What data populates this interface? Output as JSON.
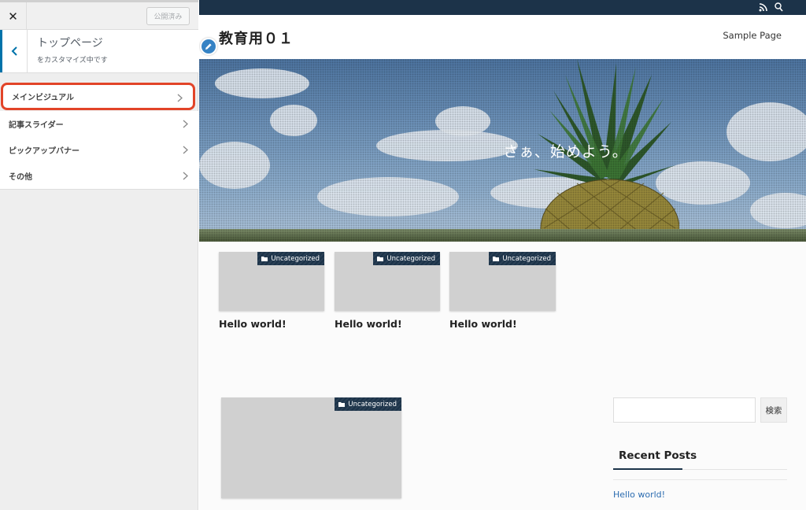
{
  "colors": {
    "accent": "#0073aa",
    "highlight": "#e24428",
    "topbar": "#1c3349",
    "link": "#2b6cb0"
  },
  "customizer": {
    "close_icon": "close-icon",
    "publish_label": "公開済み",
    "back_icon": "chevron-left-icon",
    "header_title": "トップページ",
    "header_sub": "をカスタマイズ中です",
    "items": [
      {
        "label": "メインビジュアル",
        "highlighted": true
      },
      {
        "label": "記事スライダー",
        "highlighted": false
      },
      {
        "label": "ピックアップバナー",
        "highlighted": false
      },
      {
        "label": "その他",
        "highlighted": false
      }
    ]
  },
  "site": {
    "topbar_icons": [
      "rss-icon",
      "search-icon"
    ],
    "title": "教育用０１",
    "nav": [
      "Sample Page"
    ],
    "hero_text": "さぁ、始めよう。"
  },
  "cards": [
    {
      "category": "Uncategorized",
      "title": "Hello world!"
    },
    {
      "category": "Uncategorized",
      "title": "Hello world!"
    },
    {
      "category": "Uncategorized",
      "title": "Hello world!"
    }
  ],
  "featured_card": {
    "category": "Uncategorized"
  },
  "widget": {
    "search_button": "検索",
    "recent_posts_heading": "Recent Posts",
    "recent_posts": [
      "Hello world!"
    ]
  }
}
